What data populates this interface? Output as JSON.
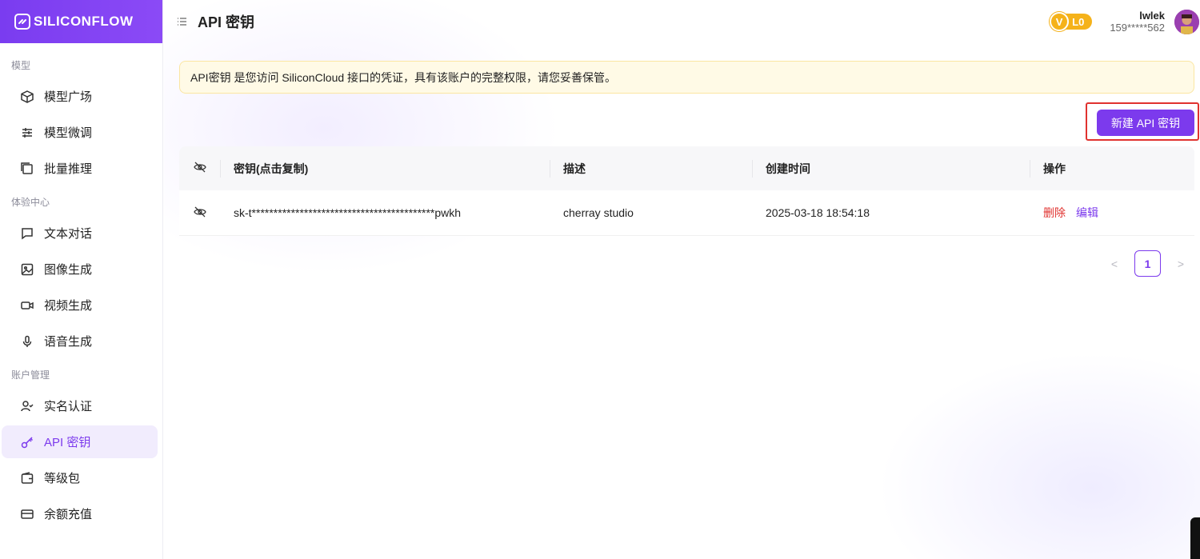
{
  "brand": {
    "name": "SILICONFLOW",
    "accent": "#7c3aed"
  },
  "header": {
    "title": "API 密钥"
  },
  "user": {
    "level": "L0",
    "level_mark": "V",
    "name": "lwlek",
    "phone": "159*****562"
  },
  "sidebar": {
    "sections": [
      {
        "label": "模型",
        "items": [
          {
            "label": "模型广场",
            "icon": "cube-icon"
          },
          {
            "label": "模型微调",
            "icon": "sliders-icon"
          },
          {
            "label": "批量推理",
            "icon": "batch-icon"
          }
        ]
      },
      {
        "label": "体验中心",
        "items": [
          {
            "label": "文本对话",
            "icon": "chat-icon"
          },
          {
            "label": "图像生成",
            "icon": "image-icon"
          },
          {
            "label": "视频生成",
            "icon": "video-icon"
          },
          {
            "label": "语音生成",
            "icon": "mic-icon"
          }
        ]
      },
      {
        "label": "账户管理",
        "items": [
          {
            "label": "实名认证",
            "icon": "user-check-icon"
          },
          {
            "label": "API 密钥",
            "icon": "key-icon",
            "active": true
          },
          {
            "label": "等级包",
            "icon": "wallet-icon"
          },
          {
            "label": "余额充值",
            "icon": "card-icon"
          }
        ]
      }
    ]
  },
  "notice": {
    "text": "API密钥 是您访问 SiliconCloud 接口的凭证，具有该账户的完整权限，请您妥善保管。"
  },
  "actions": {
    "new_key_label": "新建 API 密钥"
  },
  "table": {
    "columns": [
      "密钥(点击复制)",
      "描述",
      "创建时间",
      "操作"
    ],
    "rows": [
      {
        "key": "sk-t******************************************pwkh",
        "description": "cherray studio",
        "created": "2025-03-18 18:54:18",
        "delete_label": "删除",
        "edit_label": "编辑"
      }
    ]
  },
  "pagination": {
    "current": "1",
    "prev": "<",
    "next": ">"
  }
}
